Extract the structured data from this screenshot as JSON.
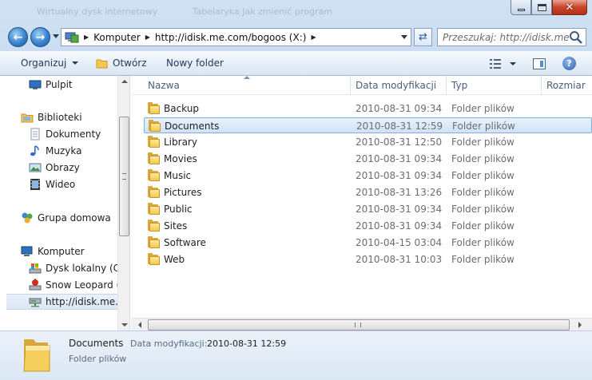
{
  "window": {
    "ghost_titles": [
      "Wirtualny dysk internetowy",
      "Tabelaryka Jak zmienić program"
    ],
    "controls": {
      "minimize": "minimize",
      "maximize": "maximize",
      "close": "✕"
    }
  },
  "address_bar": {
    "crumbs": [
      "Komputer",
      "http://idisk.me.com/bogoos (X:)"
    ],
    "search_placeholder": "Przeszukaj: http://idisk.me.com..."
  },
  "toolbar": {
    "organize_label": "Organizuj",
    "open_label": "Otwórz",
    "new_folder_label": "Nowy folder"
  },
  "nav": {
    "items": [
      {
        "label": "Pulpit",
        "icon": "desktop-icon"
      },
      {
        "label": "Biblioteki",
        "icon": "libraries-icon"
      },
      {
        "label": "Dokumenty",
        "icon": "documents-icon"
      },
      {
        "label": "Muzyka",
        "icon": "music-icon"
      },
      {
        "label": "Obrazy",
        "icon": "pictures-icon"
      },
      {
        "label": "Wideo",
        "icon": "video-icon"
      },
      {
        "label": "Grupa domowa",
        "icon": "homegroup-icon"
      },
      {
        "label": "Komputer",
        "icon": "computer-icon"
      },
      {
        "label": "Dysk lokalny (C:)",
        "icon": "local-disk-icon"
      },
      {
        "label": "Snow Leopard (D",
        "icon": "snow-leopard-icon"
      },
      {
        "label": "http://idisk.me.c",
        "icon": "network-drive-icon"
      }
    ]
  },
  "columns": {
    "name": "Nazwa",
    "date": "Data modyfikacji",
    "type": "Typ",
    "size": "Rozmiar"
  },
  "files": [
    {
      "name": "Backup",
      "date": "2010-08-31 09:34",
      "type": "Folder plików"
    },
    {
      "name": "Documents",
      "date": "2010-08-31 12:59",
      "type": "Folder plików"
    },
    {
      "name": "Library",
      "date": "2010-08-31 12:50",
      "type": "Folder plików"
    },
    {
      "name": "Movies",
      "date": "2010-08-31 09:34",
      "type": "Folder plików"
    },
    {
      "name": "Music",
      "date": "2010-08-31 09:34",
      "type": "Folder plików"
    },
    {
      "name": "Pictures",
      "date": "2010-08-31 13:26",
      "type": "Folder plików"
    },
    {
      "name": "Public",
      "date": "2010-08-31 09:34",
      "type": "Folder plików"
    },
    {
      "name": "Sites",
      "date": "2010-08-31 09:34",
      "type": "Folder plików"
    },
    {
      "name": "Software",
      "date": "2010-04-15 03:04",
      "type": "Folder plików"
    },
    {
      "name": "Web",
      "date": "2010-08-31 10:03",
      "type": "Folder plików"
    }
  ],
  "details": {
    "name": "Documents",
    "date_label": "Data modyfikacji:",
    "date_value": "2010-08-31 12:59",
    "type": "Folder plików"
  },
  "colors": {
    "accent": "#3a83cf",
    "folder": "#f2c94e",
    "selection": "#cfe3f7"
  }
}
